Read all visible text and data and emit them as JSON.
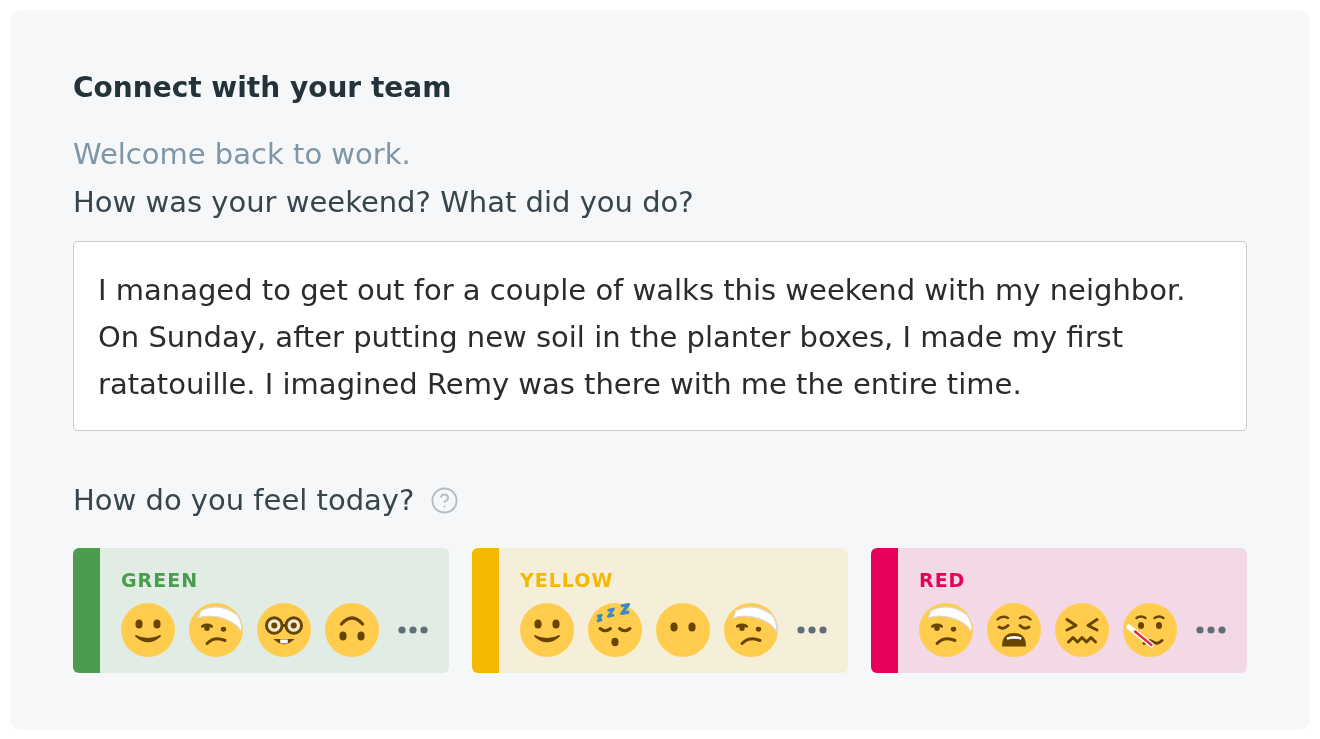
{
  "panel": {
    "title": "Connect with your team",
    "intro": "Welcome back to work.",
    "question": "How was your weekend? What did you do?",
    "answer": {
      "value": "I managed to get out for a couple of walks this weekend with my neighbor. On Sunday, after putting new soil in the planter boxes, I made my first ratatouille. I imagined Remy was there with me the entire time."
    },
    "mood_question": "How do you feel today?",
    "moods": [
      {
        "label": "GREEN",
        "color": "#4a9c4e",
        "emojis": [
          {
            "kind": "smile"
          },
          {
            "kind": "bandaged"
          },
          {
            "kind": "nerd"
          },
          {
            "kind": "upside_down"
          }
        ]
      },
      {
        "label": "YELLOW",
        "color": "#f5b800",
        "emojis": [
          {
            "kind": "smile"
          },
          {
            "kind": "sleeping"
          },
          {
            "kind": "no_mouth"
          },
          {
            "kind": "bandaged"
          }
        ]
      },
      {
        "label": "RED",
        "color": "#e8005a",
        "emojis": [
          {
            "kind": "bandaged"
          },
          {
            "kind": "weary"
          },
          {
            "kind": "confounded"
          },
          {
            "kind": "thermometer"
          }
        ]
      }
    ]
  }
}
